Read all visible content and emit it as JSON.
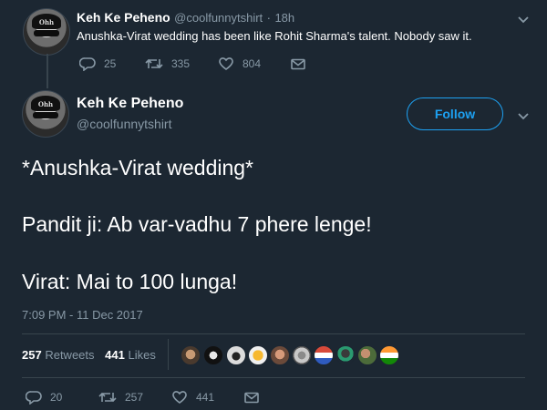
{
  "reply_tweet": {
    "author_name": "Keh Ke Peheno",
    "author_handle": "@coolfunnytshirt",
    "time": "18h",
    "text": "Anushka-Virat wedding has been like Rohit Sharma's talent. Nobody saw it.",
    "replies": "25",
    "retweets": "335",
    "likes": "804"
  },
  "main_tweet": {
    "author_name": "Keh Ke Peheno",
    "author_handle": "@coolfunnytshirt",
    "follow_label": "Follow",
    "lines": [
      "*Anushka-Virat wedding*",
      "Pandit ji: Ab var-vadhu 7 phere lenge!",
      "Virat: Mai to 100 lunga!"
    ],
    "timestamp": "7:09 PM - 11 Dec 2017",
    "retweets_count": "257",
    "retweets_label": "Retweets",
    "likes_count": "441",
    "likes_label": "Likes",
    "footer": {
      "replies": "20",
      "retweets": "257",
      "likes": "441"
    }
  },
  "avatar_cap_text": "Ohh",
  "colors": {
    "background": "#1c2732",
    "accent": "#1da1f2",
    "muted": "#8899a6",
    "divider": "#38444d"
  },
  "icons": [
    "reply-icon",
    "retweet-icon",
    "heart-icon",
    "mail-icon",
    "chevron-down-icon"
  ]
}
